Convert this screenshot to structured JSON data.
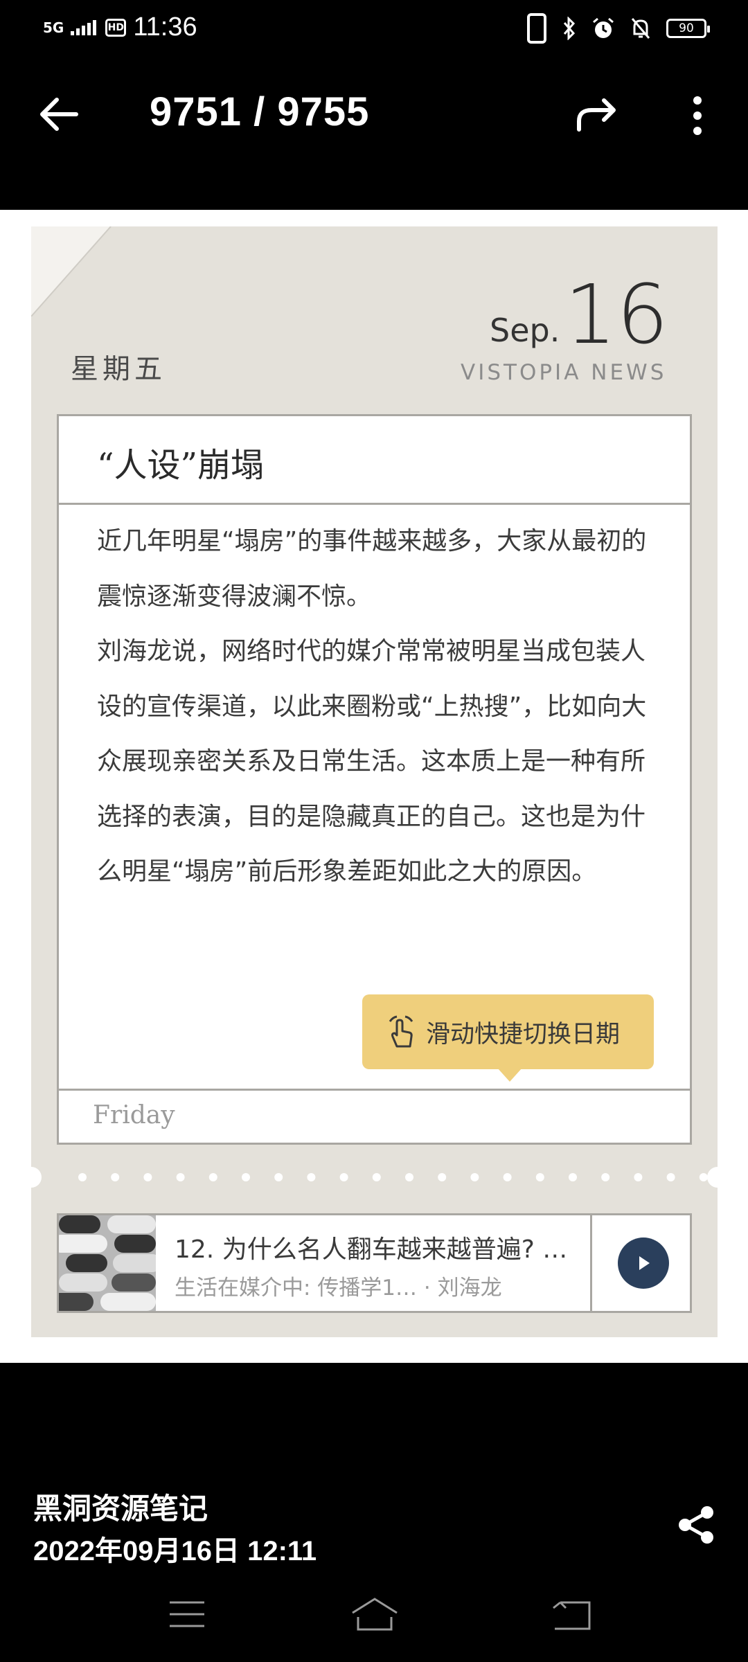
{
  "status_bar": {
    "signal": "5G",
    "hd": "HD",
    "time": "11:36",
    "battery": "90"
  },
  "top_bar": {
    "counter": "9751 / 9755",
    "icons": [
      "back-arrow-icon",
      "forward-share-icon",
      "more-vert-icon"
    ]
  },
  "card": {
    "weekday_cn": "星期五",
    "month": "Sep.",
    "day": "16",
    "brand": "VISTOPIA NEWS",
    "headline": "“人设”崩塌",
    "paragraphs": [
      "近几年明星“塌房”的事件越来越多，大家从最初的震惊逐渐变得波澜不惊。",
      "刘海龙说，网络时代的媒介常常被明星当成包装人设的宣传渠道，以此来圈粉或“上热搜”，比如向大众展现亲密关系及日常生活。这本质上是一种有所选择的表演，目的是隐藏真正的自己。这也是为什么明星“塌房”前后形象差距如此之大的原因。"
    ],
    "tip": "滑动快捷切换日期",
    "weekday_en": "Friday"
  },
  "player": {
    "title": "12. 为什么名人翻车越来越普遍? …",
    "subtitle": "生活在媒介中: 传播学1… · 刘海龙",
    "accent": "#2a3f5c"
  },
  "footer": {
    "album": "黑洞资源笔记",
    "datetime": "2022年09月16日 12:11"
  },
  "colors": {
    "card_bg": "#e4e1da",
    "tip_bg": "#efcf7c"
  }
}
